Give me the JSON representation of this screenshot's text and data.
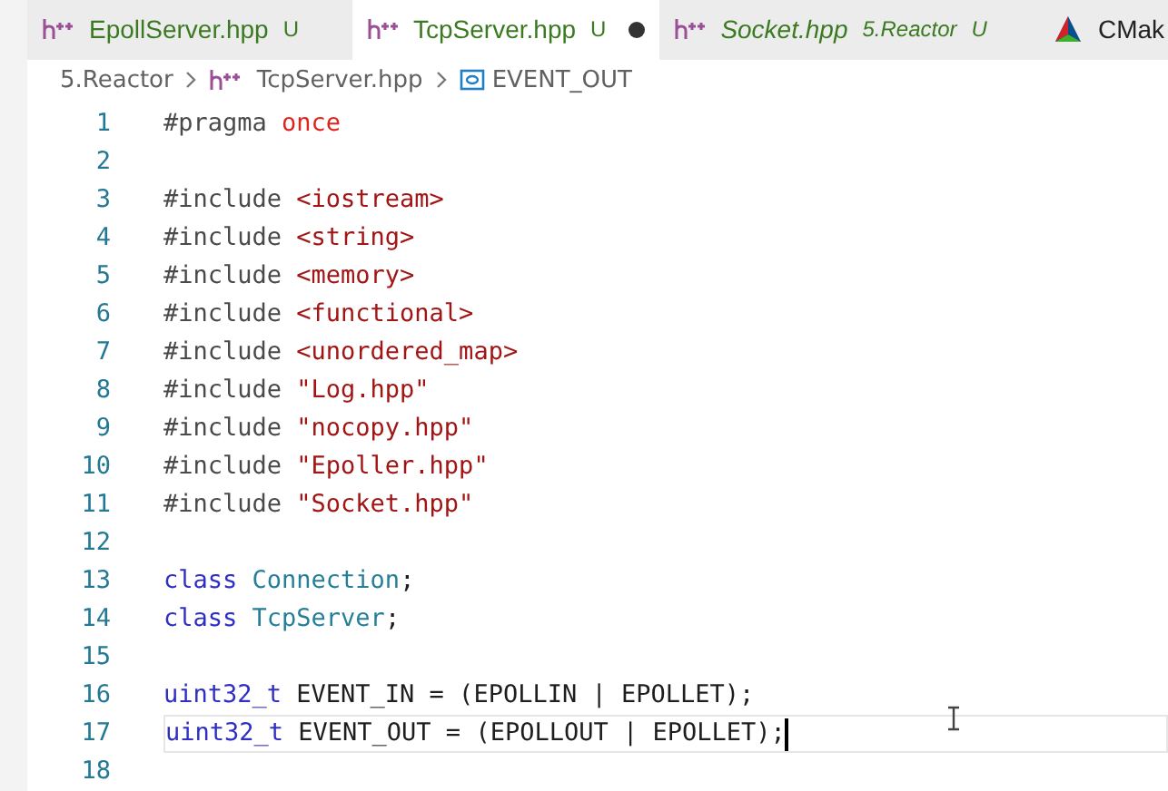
{
  "tabs": [
    {
      "label": "EpollServer.hpp",
      "status": "U",
      "selected": false,
      "modified": false,
      "preview": false,
      "kind": "cpp"
    },
    {
      "label": "TcpServer.hpp",
      "status": "U",
      "selected": true,
      "modified": true,
      "preview": false,
      "kind": "cpp"
    },
    {
      "label": "Socket.hpp",
      "description": "5.Reactor",
      "status": "U",
      "selected": false,
      "modified": false,
      "preview": true,
      "kind": "cpp"
    },
    {
      "label": "CMak",
      "selected": false,
      "preview": false,
      "kind": "cmake"
    }
  ],
  "breadcrumb": [
    {
      "label": "5.Reactor",
      "kind": "folder"
    },
    {
      "label": "TcpServer.hpp",
      "kind": "cpp"
    },
    {
      "label": "EVENT_OUT",
      "kind": "variable"
    }
  ],
  "lines": [
    {
      "number": "1",
      "tokens": [
        {
          "text": "#pragma ",
          "kind": "directive"
        },
        {
          "text": "once",
          "kind": "red"
        }
      ]
    },
    {
      "number": "2"
    },
    {
      "number": "3",
      "tokens": [
        {
          "text": "#include ",
          "kind": "directive"
        },
        {
          "text": "<iostream>",
          "kind": "string"
        }
      ]
    },
    {
      "number": "4",
      "tokens": [
        {
          "text": "#include ",
          "kind": "directive"
        },
        {
          "text": "<string>",
          "kind": "string"
        }
      ]
    },
    {
      "number": "5",
      "tokens": [
        {
          "text": "#include ",
          "kind": "directive"
        },
        {
          "text": "<memory>",
          "kind": "string"
        }
      ]
    },
    {
      "number": "6",
      "tokens": [
        {
          "text": "#include ",
          "kind": "directive"
        },
        {
          "text": "<functional>",
          "kind": "string"
        }
      ]
    },
    {
      "number": "7",
      "tokens": [
        {
          "text": "#include ",
          "kind": "directive"
        },
        {
          "text": "<unordered_map>",
          "kind": "string"
        }
      ]
    },
    {
      "number": "8",
      "tokens": [
        {
          "text": "#include ",
          "kind": "directive"
        },
        {
          "text": "\"Log.hpp\"",
          "kind": "string"
        }
      ]
    },
    {
      "number": "9",
      "tokens": [
        {
          "text": "#include ",
          "kind": "directive"
        },
        {
          "text": "\"nocopy.hpp\"",
          "kind": "string"
        }
      ]
    },
    {
      "number": "10",
      "tokens": [
        {
          "text": "#include ",
          "kind": "directive"
        },
        {
          "text": "\"Epoller.hpp\"",
          "kind": "string"
        }
      ]
    },
    {
      "number": "11",
      "tokens": [
        {
          "text": "#include ",
          "kind": "directive"
        },
        {
          "text": "\"Socket.hpp\"",
          "kind": "string"
        }
      ]
    },
    {
      "number": "12"
    },
    {
      "number": "13",
      "tokens": [
        {
          "text": "class ",
          "kind": "keyword"
        },
        {
          "text": "Connection",
          "kind": "type"
        },
        {
          "text": ";",
          "kind": "plain"
        }
      ]
    },
    {
      "number": "14",
      "tokens": [
        {
          "text": "class ",
          "kind": "keyword"
        },
        {
          "text": "TcpServer",
          "kind": "type"
        },
        {
          "text": ";",
          "kind": "plain"
        }
      ]
    },
    {
      "number": "15"
    },
    {
      "number": "16",
      "tokens": [
        {
          "text": "uint32_t ",
          "kind": "keyword"
        },
        {
          "text": "EVENT_IN = (EPOLLIN | EPOLLET);",
          "kind": "plain"
        }
      ]
    },
    {
      "number": "17",
      "current": true,
      "tokens": [
        {
          "text": "uint32_t ",
          "kind": "keyword"
        },
        {
          "text": "EVENT_OUT = (EPOLLOUT | EPOLLET);",
          "kind": "plain"
        }
      ]
    },
    {
      "number": "18"
    }
  ]
}
